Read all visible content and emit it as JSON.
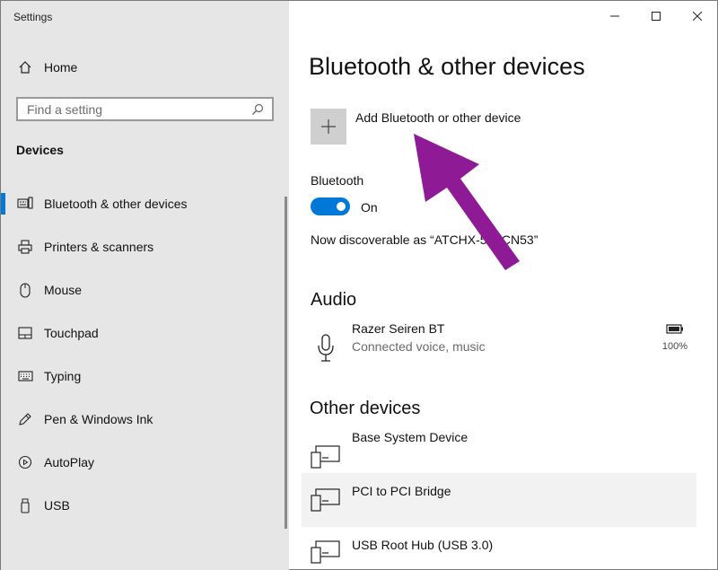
{
  "window": {
    "title": "Settings",
    "controls": {
      "minimize": "minimize",
      "maximize": "maximize",
      "close": "close"
    }
  },
  "sidebar": {
    "home_label": "Home",
    "search_placeholder": "Find a setting",
    "section": "Devices",
    "items": [
      {
        "label": "Bluetooth & other devices",
        "icon": "bluetooth-devices-icon",
        "selected": true
      },
      {
        "label": "Printers & scanners",
        "icon": "printer-icon",
        "selected": false
      },
      {
        "label": "Mouse",
        "icon": "mouse-icon",
        "selected": false
      },
      {
        "label": "Touchpad",
        "icon": "touchpad-icon",
        "selected": false
      },
      {
        "label": "Typing",
        "icon": "keyboard-icon",
        "selected": false
      },
      {
        "label": "Pen & Windows Ink",
        "icon": "pen-icon",
        "selected": false
      },
      {
        "label": "AutoPlay",
        "icon": "autoplay-icon",
        "selected": false
      },
      {
        "label": "USB",
        "icon": "usb-icon",
        "selected": false
      }
    ]
  },
  "main": {
    "title": "Bluetooth & other devices",
    "add_device_label": "Add Bluetooth or other device",
    "bluetooth_label": "Bluetooth",
    "bluetooth_state": "On",
    "discoverable_text": "Now discoverable as “ATCHX-5JACN53”",
    "audio_heading": "Audio",
    "audio_devices": [
      {
        "name": "Razer Seiren BT",
        "status": "Connected voice, music",
        "battery": "100%"
      }
    ],
    "other_heading": "Other devices",
    "other_devices": [
      {
        "name": "Base System Device"
      },
      {
        "name": "PCI to PCI Bridge"
      },
      {
        "name": "USB Root Hub (USB 3.0)"
      }
    ]
  },
  "colors": {
    "accent": "#0078d7",
    "annotation_arrow": "#8e1a96"
  }
}
